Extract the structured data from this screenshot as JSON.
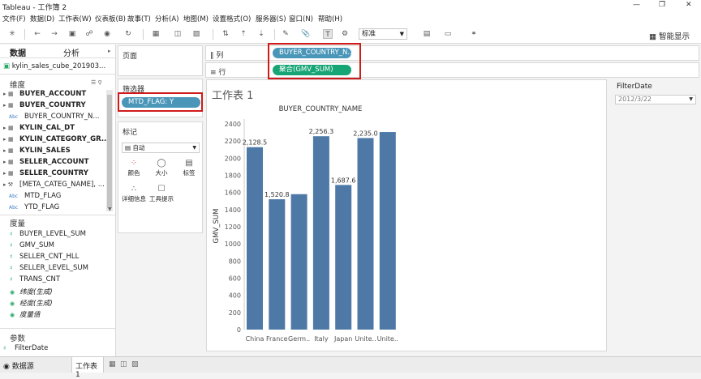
{
  "window": {
    "title": "Tableau - 工作簿 2"
  },
  "menu": [
    "文件(F)",
    "数据(D)",
    "工作表(W)",
    "仪表板(B)",
    "故事(T)",
    "分析(A)",
    "地图(M)",
    "设置格式(O)",
    "服务器(S)",
    "窗口(N)",
    "帮助(H)"
  ],
  "toolbar": {
    "fit_select": "标准",
    "smart_show": "智能显示"
  },
  "left": {
    "tab_data": "数据",
    "tab_analysis": "分析",
    "datasource": "kylin_sales_cube_201903...",
    "dimensions_title": "维度",
    "dimensions": [
      {
        "label": "BUYER_ACCOUNT",
        "bold": true,
        "icon": "table-icon"
      },
      {
        "label": "BUYER_COUNTRY",
        "bold": true,
        "icon": "table-icon"
      },
      {
        "label": "BUYER_COUNTRY_N...",
        "bold": false,
        "icon": "abc-icon"
      },
      {
        "label": "KYLIN_CAL_DT",
        "bold": true,
        "icon": "table-icon"
      },
      {
        "label": "KYLIN_CATEGORY_GR...",
        "bold": true,
        "icon": "table-icon"
      },
      {
        "label": "KYLIN_SALES",
        "bold": true,
        "icon": "table-icon"
      },
      {
        "label": "SELLER_ACCOUNT",
        "bold": true,
        "icon": "table-icon"
      },
      {
        "label": "SELLER_COUNTRY",
        "bold": true,
        "icon": "table-icon"
      },
      {
        "label": "[META_CATEG_NAME], ...",
        "bold": false,
        "icon": "group-icon"
      },
      {
        "label": "MTD_FLAG",
        "bold": false,
        "icon": "abc-icon"
      },
      {
        "label": "YTD_FLAG",
        "bold": false,
        "icon": "abc-icon"
      }
    ],
    "measures_title": "度量",
    "measures": [
      {
        "label": "BUYER_LEVEL_SUM",
        "italic": false
      },
      {
        "label": "GMV_SUM",
        "italic": false
      },
      {
        "label": "SELLER_CNT_HLL",
        "italic": false
      },
      {
        "label": "SELLER_LEVEL_SUM",
        "italic": false
      },
      {
        "label": "TRANS_CNT",
        "italic": false
      },
      {
        "label": "纬度(生成)",
        "italic": true
      },
      {
        "label": "经度(生成)",
        "italic": true
      },
      {
        "label": "度量值",
        "italic": true
      }
    ],
    "params_title": "参数",
    "params": [
      "FilterDate"
    ]
  },
  "shelves": {
    "pages": "页面",
    "filters": "筛选器",
    "filter_pill": "MTD_FLAG: Y",
    "marks": "标记",
    "marks_type": "自动",
    "mark_buttons": [
      "颜色",
      "大小",
      "标签",
      "详细信息",
      "工具提示"
    ],
    "columns_label": "列",
    "rows_label": "行",
    "columns_pill": "BUYER_COUNTRY_N..",
    "rows_pill": "聚合(GMV_SUM)"
  },
  "sheet": {
    "title": "工作表 1"
  },
  "filter_card": {
    "title": "FilterDate",
    "value": "2012/3/22"
  },
  "bottom": {
    "datasource": "数据源",
    "sheet_tab": "工作表 1"
  },
  "chart_data": {
    "type": "bar",
    "title": "BUYER_COUNTRY_NAME",
    "ylabel": "GMV_SUM",
    "xlabel": "",
    "categories": [
      "China",
      "France",
      "Germ..",
      "Italy",
      "Japan",
      "Unite..",
      "Unite.."
    ],
    "values": [
      2128.5,
      1520.8,
      1580,
      2256.3,
      1687.6,
      2235.0,
      2305
    ],
    "data_labels": [
      "2,128.5",
      "1,520.8",
      "",
      "2,256.3",
      "1,687.6",
      "2,235.0",
      ""
    ],
    "ylim": [
      0,
      2400
    ],
    "yticks": [
      "0",
      "200",
      "400",
      "600",
      "800",
      "1000",
      "1200",
      "1400",
      "1600",
      "1800",
      "2000",
      "2200",
      "2400"
    ],
    "color": "#4e79a7"
  }
}
